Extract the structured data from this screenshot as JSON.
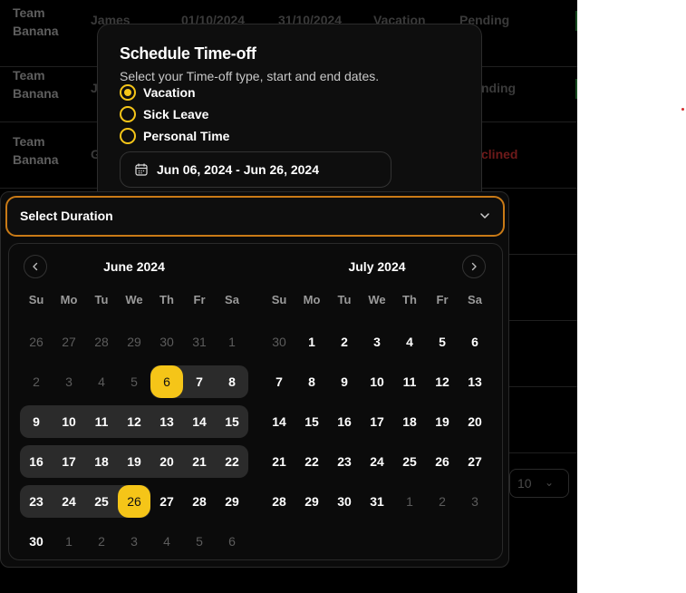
{
  "background_rows": [
    {
      "team": "Team Banana",
      "name": "James",
      "start": "01/10/2024",
      "end": "31/10/2024",
      "type": "Vacation",
      "status": "Pending"
    },
    {
      "team": "Team Banana",
      "name": "J",
      "start": "",
      "end": "",
      "type": "",
      "status": "nding"
    },
    {
      "team": "Team Banana",
      "name": "G",
      "start": "",
      "end": "",
      "type": "",
      "status": "clined"
    }
  ],
  "pager": {
    "page_size": "10"
  },
  "dialog": {
    "title": "Schedule Time-off",
    "subtitle": "Select your Time-off type, start and end dates.",
    "options": [
      {
        "label": "Vacation",
        "selected": true
      },
      {
        "label": "Sick Leave",
        "selected": false
      },
      {
        "label": "Personal Time",
        "selected": false
      }
    ],
    "date_range": "Jun 06, 2024 - Jun 26, 2024"
  },
  "duration_select": {
    "label": "Select Duration"
  },
  "calendar": {
    "weekdays": [
      "Su",
      "Mo",
      "Tu",
      "We",
      "Th",
      "Fr",
      "Sa"
    ],
    "accent": "#f5c518",
    "months": [
      {
        "title": "June 2024",
        "weeks": [
          [
            {
              "d": "26",
              "m": true
            },
            {
              "d": "27",
              "m": true
            },
            {
              "d": "28",
              "m": true
            },
            {
              "d": "29",
              "m": true
            },
            {
              "d": "30",
              "m": true
            },
            {
              "d": "31",
              "m": true
            },
            {
              "d": "1",
              "m": true
            }
          ],
          [
            {
              "d": "2",
              "m": true
            },
            {
              "d": "3",
              "m": true
            },
            {
              "d": "4",
              "m": true
            },
            {
              "d": "5",
              "m": true
            },
            {
              "d": "6",
              "s": true
            },
            {
              "d": "7"
            },
            {
              "d": "8"
            }
          ],
          [
            {
              "d": "9"
            },
            {
              "d": "10"
            },
            {
              "d": "11"
            },
            {
              "d": "12"
            },
            {
              "d": "13"
            },
            {
              "d": "14"
            },
            {
              "d": "15"
            }
          ],
          [
            {
              "d": "16"
            },
            {
              "d": "17"
            },
            {
              "d": "18"
            },
            {
              "d": "19"
            },
            {
              "d": "20"
            },
            {
              "d": "21"
            },
            {
              "d": "22"
            }
          ],
          [
            {
              "d": "23"
            },
            {
              "d": "24"
            },
            {
              "d": "25"
            },
            {
              "d": "26",
              "s": true
            },
            {
              "d": "27"
            },
            {
              "d": "28"
            },
            {
              "d": "29"
            }
          ],
          [
            {
              "d": "30"
            },
            {
              "d": "1",
              "m": true
            },
            {
              "d": "2",
              "m": true
            },
            {
              "d": "3",
              "m": true
            },
            {
              "d": "4",
              "m": true
            },
            {
              "d": "5",
              "m": true
            },
            {
              "d": "6",
              "m": true
            }
          ]
        ]
      },
      {
        "title": "July 2024",
        "weeks": [
          [
            {
              "d": "30",
              "m": true
            },
            {
              "d": "1"
            },
            {
              "d": "2"
            },
            {
              "d": "3"
            },
            {
              "d": "4"
            },
            {
              "d": "5"
            },
            {
              "d": "6"
            }
          ],
          [
            {
              "d": "7"
            },
            {
              "d": "8"
            },
            {
              "d": "9"
            },
            {
              "d": "10"
            },
            {
              "d": "11"
            },
            {
              "d": "12"
            },
            {
              "d": "13"
            }
          ],
          [
            {
              "d": "14"
            },
            {
              "d": "15"
            },
            {
              "d": "16"
            },
            {
              "d": "17"
            },
            {
              "d": "18"
            },
            {
              "d": "19"
            },
            {
              "d": "20"
            }
          ],
          [
            {
              "d": "21"
            },
            {
              "d": "22"
            },
            {
              "d": "23"
            },
            {
              "d": "24"
            },
            {
              "d": "25"
            },
            {
              "d": "26"
            },
            {
              "d": "27"
            }
          ],
          [
            {
              "d": "28"
            },
            {
              "d": "29"
            },
            {
              "d": "30"
            },
            {
              "d": "31"
            },
            {
              "d": "1",
              "m": true
            },
            {
              "d": "2",
              "m": true
            },
            {
              "d": "3",
              "m": true
            }
          ]
        ]
      }
    ]
  }
}
